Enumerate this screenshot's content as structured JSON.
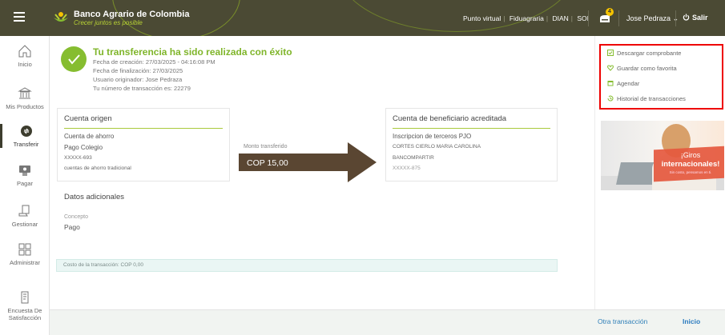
{
  "header": {
    "brand_name": "Banco Agrario de Colombia",
    "brand_slogan": "Crecer juntos es posible",
    "links": [
      "Punto virtual",
      "Fiduagraria",
      "DIAN",
      "SOI"
    ],
    "notification_count": "4",
    "user_name": "Jose Pedraza",
    "logout_label": "Salir"
  },
  "sidebar": {
    "items": [
      {
        "label": "Inicio",
        "icon": "home-icon"
      },
      {
        "label": "Mis Productos",
        "icon": "bank-icon"
      },
      {
        "label": "Transferir",
        "icon": "transfer-icon",
        "active": true
      },
      {
        "label": "Pagar",
        "icon": "pay-icon"
      },
      {
        "label": "Gestionar",
        "icon": "manage-icon"
      },
      {
        "label": "Administrar",
        "icon": "grid-icon"
      },
      {
        "label": "Encuesta De Satisfacción",
        "icon": "survey-icon"
      }
    ]
  },
  "confirmation": {
    "title": "Tu transferencia ha sido realizada con éxito",
    "created": "Fecha de creación: 27/03/2025 - 04:16:08 PM",
    "finished": "Fecha de finalización: 27/03/2025",
    "originator": "Usuario originador: Jose Pedraza",
    "transaction": "Tu número de transacción es: 22279"
  },
  "origin": {
    "title": "Cuenta origen",
    "account_type": "Cuenta de ahorro",
    "alias": "Pago Colegio",
    "number": "XXXXX-693",
    "product": "cuentas de ahorro tradicional"
  },
  "transfer": {
    "amount_label": "Monto transferido",
    "amount": "COP 15,00"
  },
  "beneficiary": {
    "title": "Cuenta de beneficiario acreditada",
    "type": "Inscripcion de terceros PJO",
    "name": "CORTES CIERLO MARIA CAROLINA",
    "bank": "BANCOMPARTIR",
    "number": "XXXXX-875"
  },
  "extra": {
    "title": "Datos adicionales",
    "concept_label": "Concepto",
    "concept_value": "Pago"
  },
  "cost": "Costo de la transacción: COP 0,00",
  "actions": [
    {
      "label": "Descargar comprobante",
      "icon": "download-icon"
    },
    {
      "label": "Guardar como favorita",
      "icon": "heart-icon"
    },
    {
      "label": "Agendar",
      "icon": "calendar-icon"
    },
    {
      "label": "Historial de transacciones",
      "icon": "history-icon"
    }
  ],
  "promo": {
    "line1": "¡Giros",
    "line2": "internacionales!",
    "line3": "Sin costo, pensamos en ti."
  },
  "footer": {
    "other_label": "Otra transacción",
    "home_label": "Inicio"
  },
  "colors": {
    "header_bg": "#4b4a34",
    "accent_green": "#86bd30",
    "link_blue": "#2b7bbf",
    "highlight_red": "#ee0000"
  }
}
